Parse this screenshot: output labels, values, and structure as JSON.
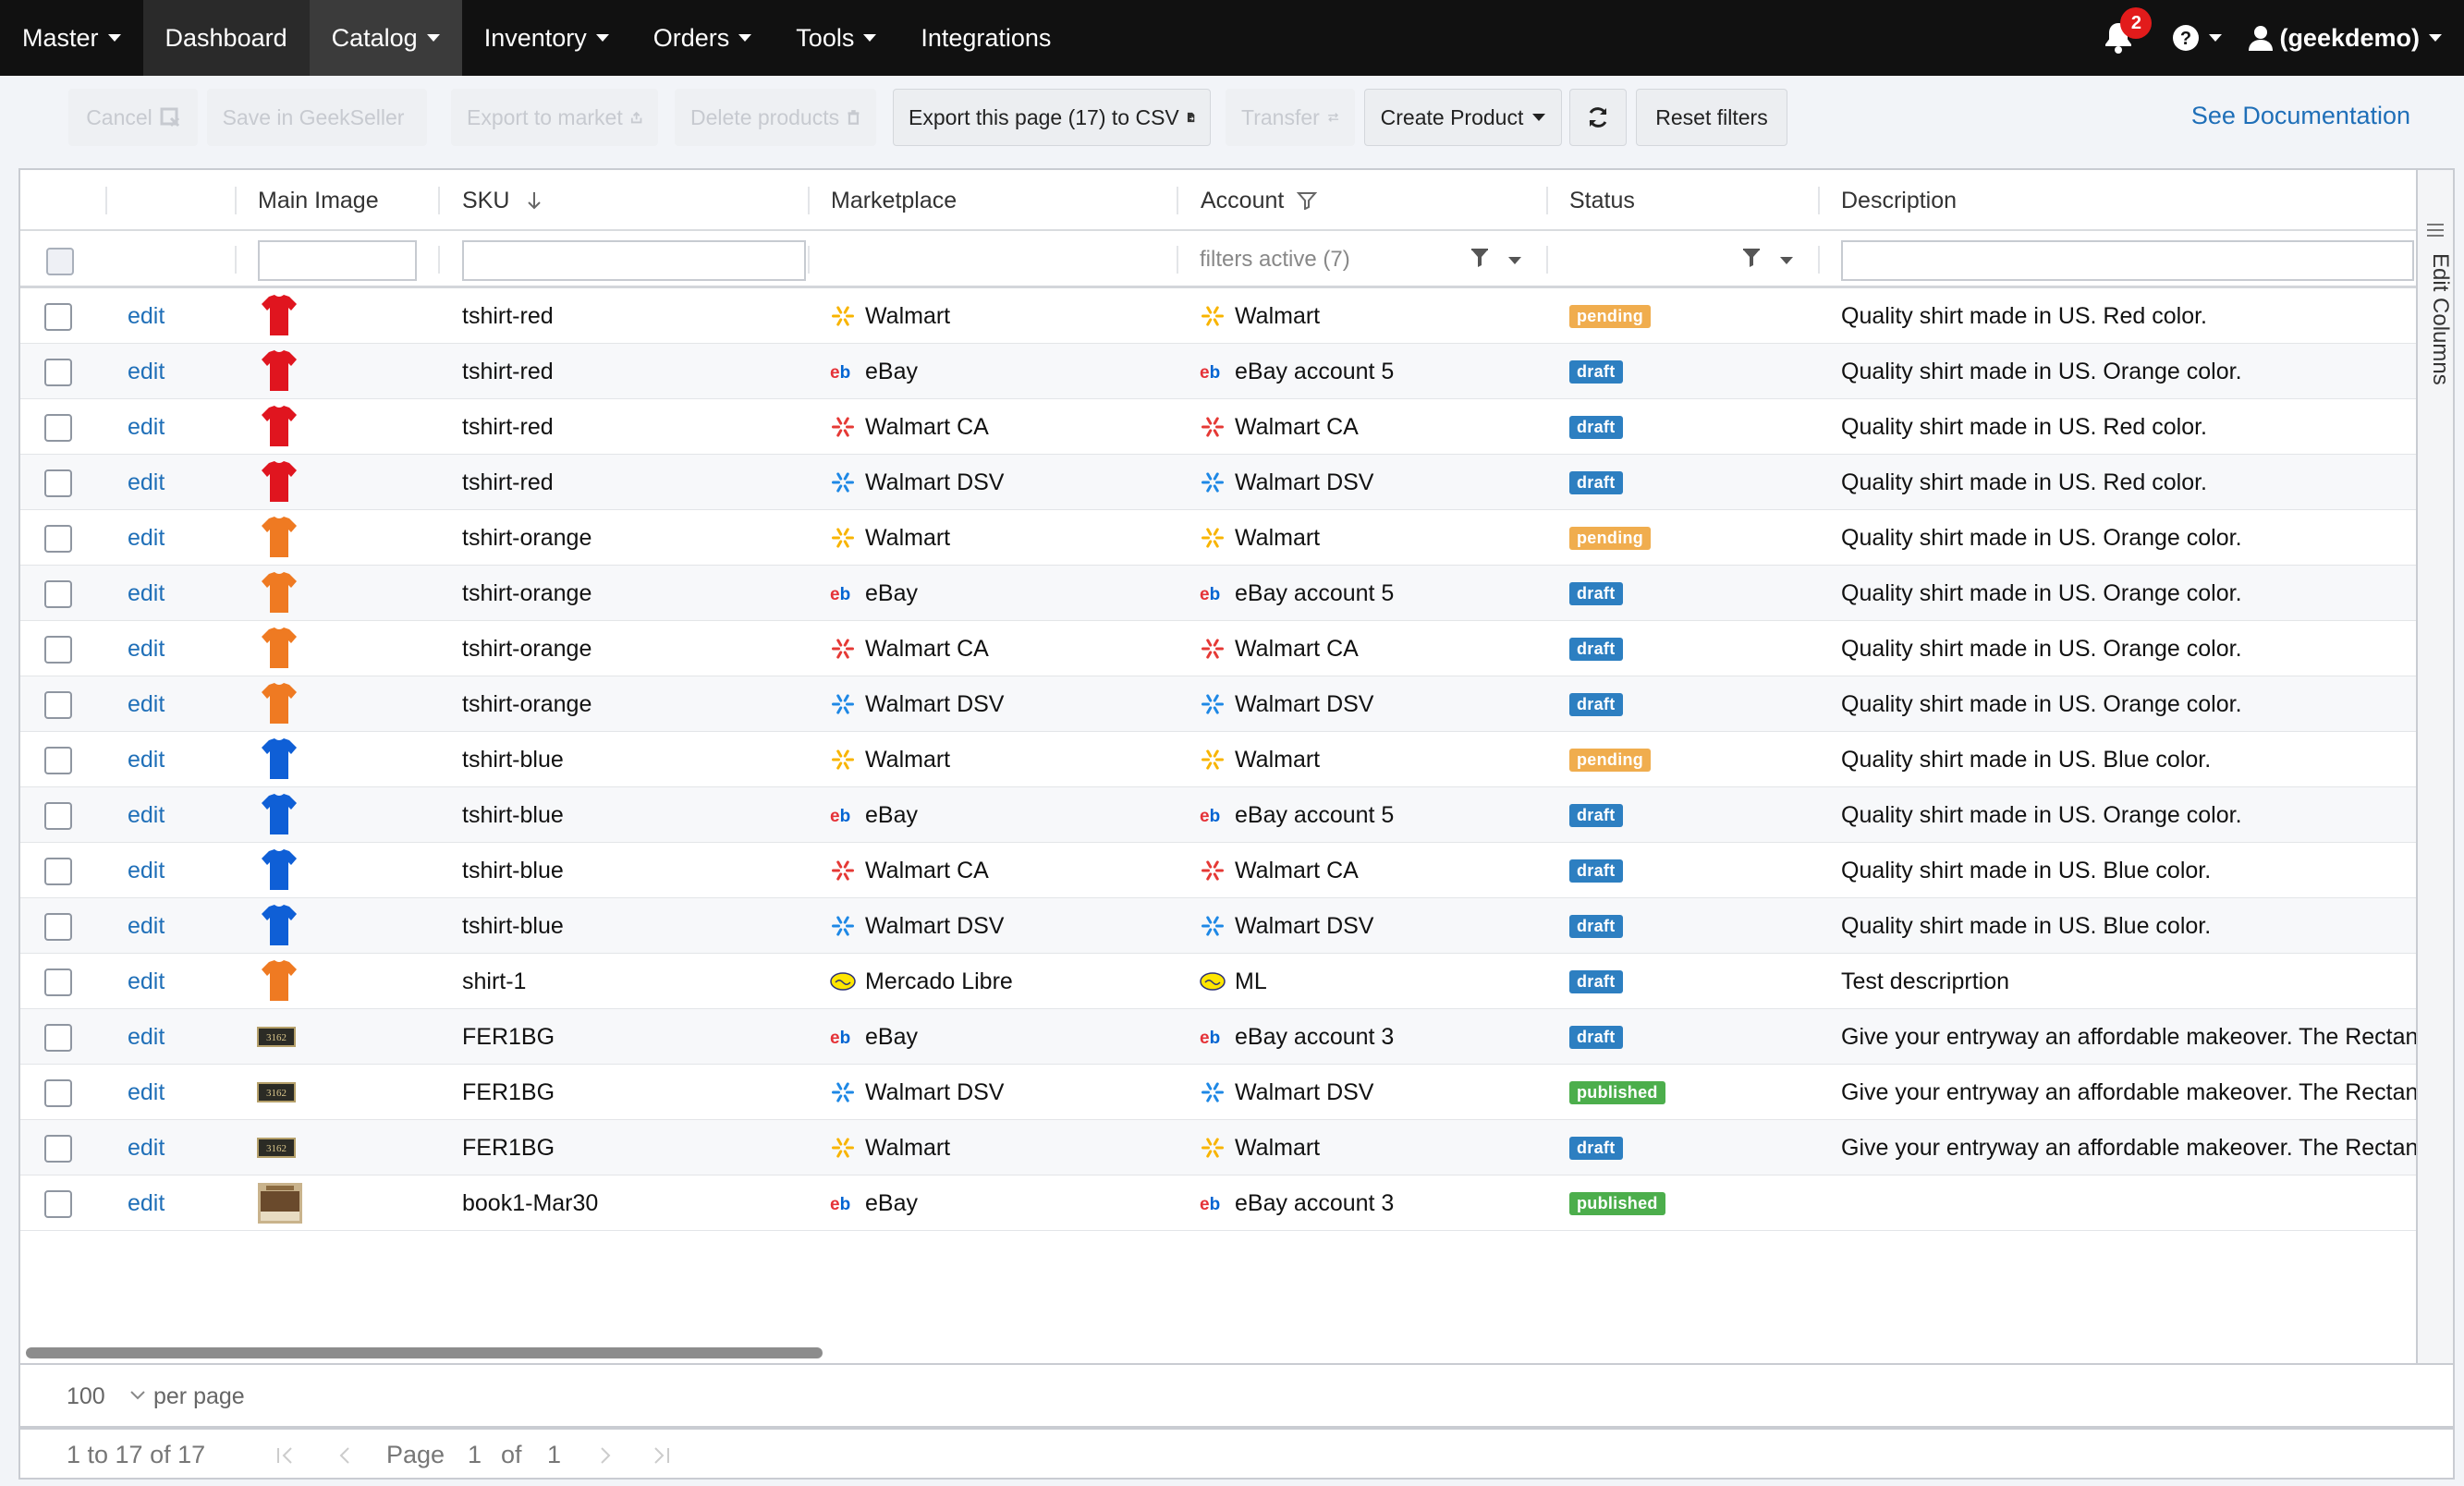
{
  "nav": {
    "items": [
      {
        "label": "Master"
      },
      {
        "label": "Dashboard"
      },
      {
        "label": "Catalog"
      },
      {
        "label": "Inventory"
      },
      {
        "label": "Orders"
      },
      {
        "label": "Tools"
      },
      {
        "label": "Integrations"
      }
    ],
    "notification_count": "2",
    "user_label": "(geekdemo)"
  },
  "toolbar": {
    "cancel": "Cancel",
    "save": "Save in GeekSeller",
    "export_market": "Export to market",
    "delete": "Delete products",
    "export_csv": "Export this page (17) to CSV",
    "transfer": "Transfer",
    "create_product": "Create Product",
    "reset_filters": "Reset filters",
    "documentation": "See Documentation"
  },
  "grid": {
    "columns": [
      "Main Image",
      "SKU",
      "Marketplace",
      "Account",
      "Status",
      "Description"
    ],
    "account_filter": "filters active (7)",
    "edit_label": "edit",
    "side_panel": "Edit Columns",
    "rows": [
      {
        "img": "red",
        "sku": "tshirt-red",
        "mkt": "Walmart",
        "mkt_icon": "walmart",
        "acct": "Walmart",
        "acct_icon": "walmart",
        "status": "pending",
        "desc": "Quality shirt made in US. Red color."
      },
      {
        "img": "red",
        "sku": "tshirt-red",
        "mkt": "eBay",
        "mkt_icon": "ebay",
        "acct": "eBay account 5",
        "acct_icon": "ebay",
        "status": "draft",
        "desc": "Quality shirt made in US. Orange color."
      },
      {
        "img": "red",
        "sku": "tshirt-red",
        "mkt": "Walmart CA",
        "mkt_icon": "walmart-ca",
        "acct": "Walmart CA",
        "acct_icon": "walmart-ca",
        "status": "draft",
        "desc": "Quality shirt made in US. Red color."
      },
      {
        "img": "red",
        "sku": "tshirt-red",
        "mkt": "Walmart DSV",
        "mkt_icon": "walmart-dsv",
        "acct": "Walmart DSV",
        "acct_icon": "walmart-dsv",
        "status": "draft",
        "desc": "Quality shirt made in US. Red color."
      },
      {
        "img": "orange",
        "sku": "tshirt-orange",
        "mkt": "Walmart",
        "mkt_icon": "walmart",
        "acct": "Walmart",
        "acct_icon": "walmart",
        "status": "pending",
        "desc": "Quality shirt made in US. Orange color."
      },
      {
        "img": "orange",
        "sku": "tshirt-orange",
        "mkt": "eBay",
        "mkt_icon": "ebay",
        "acct": "eBay account 5",
        "acct_icon": "ebay",
        "status": "draft",
        "desc": "Quality shirt made in US. Orange color."
      },
      {
        "img": "orange",
        "sku": "tshirt-orange",
        "mkt": "Walmart CA",
        "mkt_icon": "walmart-ca",
        "acct": "Walmart CA",
        "acct_icon": "walmart-ca",
        "status": "draft",
        "desc": "Quality shirt made in US. Orange color."
      },
      {
        "img": "orange",
        "sku": "tshirt-orange",
        "mkt": "Walmart DSV",
        "mkt_icon": "walmart-dsv",
        "acct": "Walmart DSV",
        "acct_icon": "walmart-dsv",
        "status": "draft",
        "desc": "Quality shirt made in US. Orange color."
      },
      {
        "img": "blue",
        "sku": "tshirt-blue",
        "mkt": "Walmart",
        "mkt_icon": "walmart",
        "acct": "Walmart",
        "acct_icon": "walmart",
        "status": "pending",
        "desc": "Quality shirt made in US. Blue color."
      },
      {
        "img": "blue",
        "sku": "tshirt-blue",
        "mkt": "eBay",
        "mkt_icon": "ebay",
        "acct": "eBay account 5",
        "acct_icon": "ebay",
        "status": "draft",
        "desc": "Quality shirt made in US. Orange color."
      },
      {
        "img": "blue",
        "sku": "tshirt-blue",
        "mkt": "Walmart CA",
        "mkt_icon": "walmart-ca",
        "acct": "Walmart CA",
        "acct_icon": "walmart-ca",
        "status": "draft",
        "desc": "Quality shirt made in US. Blue color."
      },
      {
        "img": "blue",
        "sku": "tshirt-blue",
        "mkt": "Walmart DSV",
        "mkt_icon": "walmart-dsv",
        "acct": "Walmart DSV",
        "acct_icon": "walmart-dsv",
        "status": "draft",
        "desc": "Quality shirt made in US. Blue color."
      },
      {
        "img": "orange",
        "sku": "shirt-1",
        "mkt": "Mercado Libre",
        "mkt_icon": "mercadolibre",
        "acct": "ML",
        "acct_icon": "mercadolibre",
        "status": "draft",
        "desc": "Test descriprtion"
      },
      {
        "img": "plaque",
        "sku": "FER1BG",
        "mkt": "eBay",
        "mkt_icon": "ebay",
        "acct": "eBay account 3",
        "acct_icon": "ebay",
        "status": "draft",
        "desc": "Give your entryway an affordable makeover. The Rectangular"
      },
      {
        "img": "plaque",
        "sku": "FER1BG",
        "mkt": "Walmart DSV",
        "mkt_icon": "walmart-dsv",
        "acct": "Walmart DSV",
        "acct_icon": "walmart-dsv",
        "status": "published",
        "desc": "Give your entryway an affordable makeover. The Rectangular"
      },
      {
        "img": "plaque",
        "sku": "FER1BG",
        "mkt": "Walmart",
        "mkt_icon": "walmart",
        "acct": "Walmart",
        "acct_icon": "walmart",
        "status": "draft",
        "desc": "Give your entryway an affordable makeover. The Rectangular"
      },
      {
        "img": "book",
        "sku": "book1-Mar30",
        "mkt": "eBay",
        "mkt_icon": "ebay",
        "acct": "eBay account 3",
        "acct_icon": "ebay",
        "status": "published",
        "desc": ""
      }
    ],
    "plaque_text": "3162"
  },
  "pagination": {
    "page_size": "100",
    "per_page_label": "per page",
    "range": "1 to 17 of 17",
    "page_label": "Page",
    "current_page": "1",
    "of_label": "of",
    "total_pages": "1"
  },
  "colors": {
    "nav_bg": "#111111",
    "link": "#1f6fb8",
    "pending": "#f0ad4e",
    "draft": "#2d7fc1",
    "published": "#4cae4c",
    "shirt_red": "#e0151f",
    "shirt_orange": "#ef7a22",
    "shirt_blue": "#0f5fd6"
  }
}
